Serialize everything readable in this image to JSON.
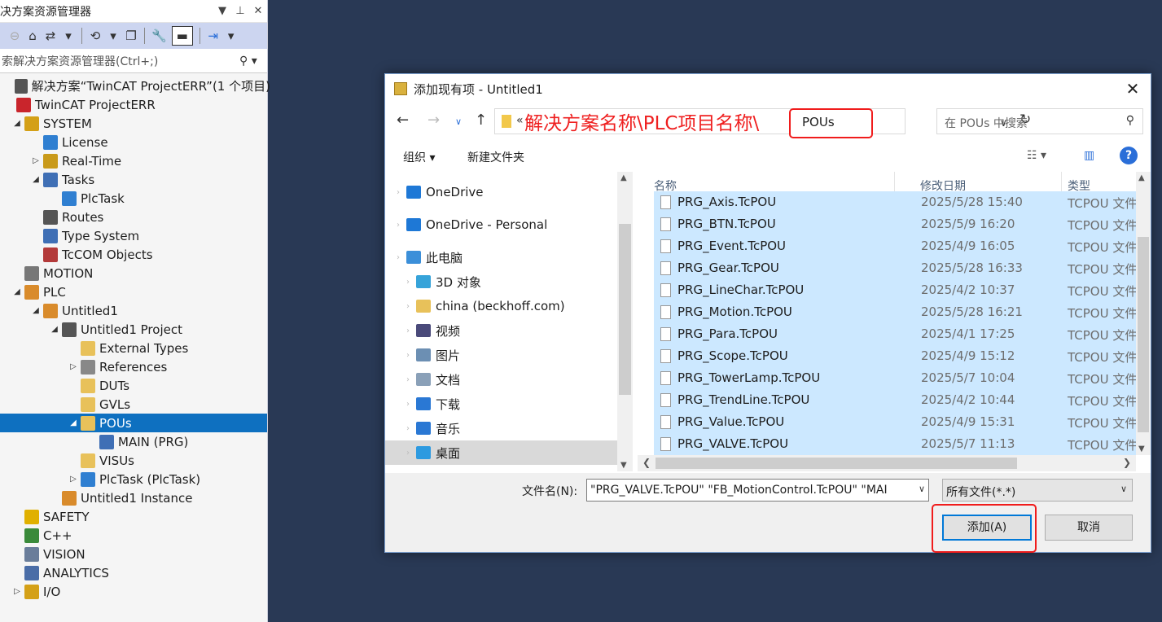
{
  "solution_explorer": {
    "title": "决方案资源管理器",
    "title_controls": [
      "▼",
      "⊥",
      "✕"
    ],
    "search_placeholder": "索解决方案资源管理器(Ctrl+;)",
    "search_icon": "search-icon",
    "tree": [
      {
        "label": "解决方案“TwinCAT ProjectERR”(1 个项目)",
        "depth": 0,
        "arrow": "",
        "icon": "solution-icon",
        "color": "#555555"
      },
      {
        "label": "TwinCAT ProjectERR",
        "depth": 0,
        "arrow": "",
        "icon": "twincat-project-icon",
        "color": "#c9252c"
      },
      {
        "label": "SYSTEM",
        "depth": 1,
        "arrow": "◢",
        "icon": "system-icon",
        "color": "#d4a017"
      },
      {
        "label": "License",
        "depth": 2,
        "arrow": "",
        "icon": "license-icon",
        "color": "#2f7fd1"
      },
      {
        "label": "Real-Time",
        "depth": 2,
        "arrow": "▷",
        "icon": "realtime-icon",
        "color": "#c99a1a"
      },
      {
        "label": "Tasks",
        "depth": 2,
        "arrow": "◢",
        "icon": "tasks-icon",
        "color": "#3f6fb5"
      },
      {
        "label": "PlcTask",
        "depth": 3,
        "arrow": "",
        "icon": "task-icon",
        "color": "#2f7fd1"
      },
      {
        "label": "Routes",
        "depth": 2,
        "arrow": "",
        "icon": "routes-icon",
        "color": "#555555"
      },
      {
        "label": "Type System",
        "depth": 2,
        "arrow": "",
        "icon": "type-system-icon",
        "color": "#3f6fb5"
      },
      {
        "label": "TcCOM Objects",
        "depth": 2,
        "arrow": "",
        "icon": "tccom-icon",
        "color": "#b33a3a"
      },
      {
        "label": "MOTION",
        "depth": 1,
        "arrow": "",
        "icon": "motion-icon",
        "color": "#777777"
      },
      {
        "label": "PLC",
        "depth": 1,
        "arrow": "◢",
        "icon": "plc-icon",
        "color": "#d98b2b"
      },
      {
        "label": "Untitled1",
        "depth": 2,
        "arrow": "◢",
        "icon": "plc-project-icon",
        "color": "#d98b2b"
      },
      {
        "label": "Untitled1 Project",
        "depth": 3,
        "arrow": "◢",
        "icon": "project-icon",
        "color": "#555555"
      },
      {
        "label": "External Types",
        "depth": 4,
        "arrow": "",
        "icon": "folder-icon",
        "color": "#e8c15a"
      },
      {
        "label": "References",
        "depth": 4,
        "arrow": "▷",
        "icon": "references-icon",
        "color": "#888888"
      },
      {
        "label": "DUTs",
        "depth": 4,
        "arrow": "",
        "icon": "folder-icon",
        "color": "#e8c15a"
      },
      {
        "label": "GVLs",
        "depth": 4,
        "arrow": "",
        "icon": "folder-icon",
        "color": "#e8c15a"
      },
      {
        "label": "POUs",
        "depth": 4,
        "arrow": "◢",
        "icon": "folder-open-icon",
        "color": "#e8c15a",
        "selected": true
      },
      {
        "label": "MAIN (PRG)",
        "depth": 5,
        "arrow": "",
        "icon": "pou-icon",
        "color": "#3f6fb5"
      },
      {
        "label": "VISUs",
        "depth": 4,
        "arrow": "",
        "icon": "folder-icon",
        "color": "#e8c15a"
      },
      {
        "label": "PlcTask (PlcTask)",
        "depth": 4,
        "arrow": "▷",
        "icon": "task-icon",
        "color": "#2f7fd1"
      },
      {
        "label": "Untitled1 Instance",
        "depth": 3,
        "arrow": "",
        "icon": "instance-icon",
        "color": "#d98b2b"
      },
      {
        "label": "SAFETY",
        "depth": 1,
        "arrow": "",
        "icon": "safety-icon",
        "color": "#e0b000"
      },
      {
        "label": "C++",
        "depth": 1,
        "arrow": "",
        "icon": "cpp-icon",
        "color": "#3a8a3a"
      },
      {
        "label": "VISION",
        "depth": 1,
        "arrow": "",
        "icon": "vision-icon",
        "color": "#6a7d9a"
      },
      {
        "label": "ANALYTICS",
        "depth": 1,
        "arrow": "",
        "icon": "analytics-icon",
        "color": "#4a6da7"
      },
      {
        "label": "I/O",
        "depth": 1,
        "arrow": "▷",
        "icon": "io-icon",
        "color": "#d4a017"
      }
    ]
  },
  "dialog": {
    "title": "添加现有项 - Untitled1",
    "address_dots": "«",
    "address_annotation": "解决方案名称\\PLC项目名称\\",
    "address_current": "POUs",
    "search_placeholder": "在 POUs 中搜索",
    "organize_label": "组织 ▾",
    "new_folder_label": "新建文件夹",
    "help_label": "?",
    "nav_items": [
      {
        "label": "OneDrive",
        "icon": "onedrive-icon",
        "color": "#1e78d6",
        "indent": 0,
        "selected": false
      },
      {
        "label": "OneDrive - Personal",
        "icon": "onedrive-icon",
        "color": "#1e78d6",
        "indent": 0,
        "selected": false
      },
      {
        "label": "此电脑",
        "icon": "this-pc-icon",
        "color": "#3b8fd9",
        "indent": 0,
        "selected": false
      },
      {
        "label": "3D 对象",
        "icon": "3d-objects-icon",
        "color": "#36a3d9",
        "indent": 1,
        "selected": false
      },
      {
        "label": "china (beckhoff.com)",
        "icon": "network-folder-icon",
        "color": "#e8c15a",
        "indent": 1,
        "selected": false
      },
      {
        "label": "视频",
        "icon": "video-icon",
        "color": "#4a4a7a",
        "indent": 1,
        "selected": false
      },
      {
        "label": "图片",
        "icon": "pictures-icon",
        "color": "#6c8fb3",
        "indent": 1,
        "selected": false
      },
      {
        "label": "文档",
        "icon": "documents-icon",
        "color": "#8aa0b8",
        "indent": 1,
        "selected": false
      },
      {
        "label": "下载",
        "icon": "downloads-icon",
        "color": "#2a78d4",
        "indent": 1,
        "selected": false
      },
      {
        "label": "音乐",
        "icon": "music-icon",
        "color": "#2a78d4",
        "indent": 1,
        "selected": true
      },
      {
        "label": "桌面",
        "icon": "desktop-icon",
        "color": "#2d9ae0",
        "indent": 1,
        "selected": true
      }
    ],
    "columns": [
      "名称",
      "修改日期",
      "类型"
    ],
    "files": [
      {
        "name": "PRG_Axis.TcPOU",
        "date": "2025/5/28 15:40",
        "type": "TCPOU 文件"
      },
      {
        "name": "PRG_BTN.TcPOU",
        "date": "2025/5/9 16:20",
        "type": "TCPOU 文件"
      },
      {
        "name": "PRG_Event.TcPOU",
        "date": "2025/4/9 16:05",
        "type": "TCPOU 文件"
      },
      {
        "name": "PRG_Gear.TcPOU",
        "date": "2025/5/28 16:33",
        "type": "TCPOU 文件"
      },
      {
        "name": "PRG_LineChar.TcPOU",
        "date": "2025/4/2 10:37",
        "type": "TCPOU 文件"
      },
      {
        "name": "PRG_Motion.TcPOU",
        "date": "2025/5/28 16:21",
        "type": "TCPOU 文件"
      },
      {
        "name": "PRG_Para.TcPOU",
        "date": "2025/4/1 17:25",
        "type": "TCPOU 文件"
      },
      {
        "name": "PRG_Scope.TcPOU",
        "date": "2025/4/9 15:12",
        "type": "TCPOU 文件"
      },
      {
        "name": "PRG_TowerLamp.TcPOU",
        "date": "2025/5/7 10:04",
        "type": "TCPOU 文件"
      },
      {
        "name": "PRG_TrendLine.TcPOU",
        "date": "2025/4/2 10:44",
        "type": "TCPOU 文件"
      },
      {
        "name": "PRG_Value.TcPOU",
        "date": "2025/4/9 15:31",
        "type": "TCPOU 文件"
      },
      {
        "name": "PRG_VALVE.TcPOU",
        "date": "2025/5/7 11:13",
        "type": "TCPOU 文件"
      }
    ],
    "filename_label": "文件名(N):",
    "filename_value": "\"PRG_VALVE.TcPOU\" \"FB_MotionControl.TcPOU\" \"MAI",
    "filetype_value": "所有文件(*.*)",
    "add_label": "添加(A)",
    "cancel_label": "取消"
  }
}
